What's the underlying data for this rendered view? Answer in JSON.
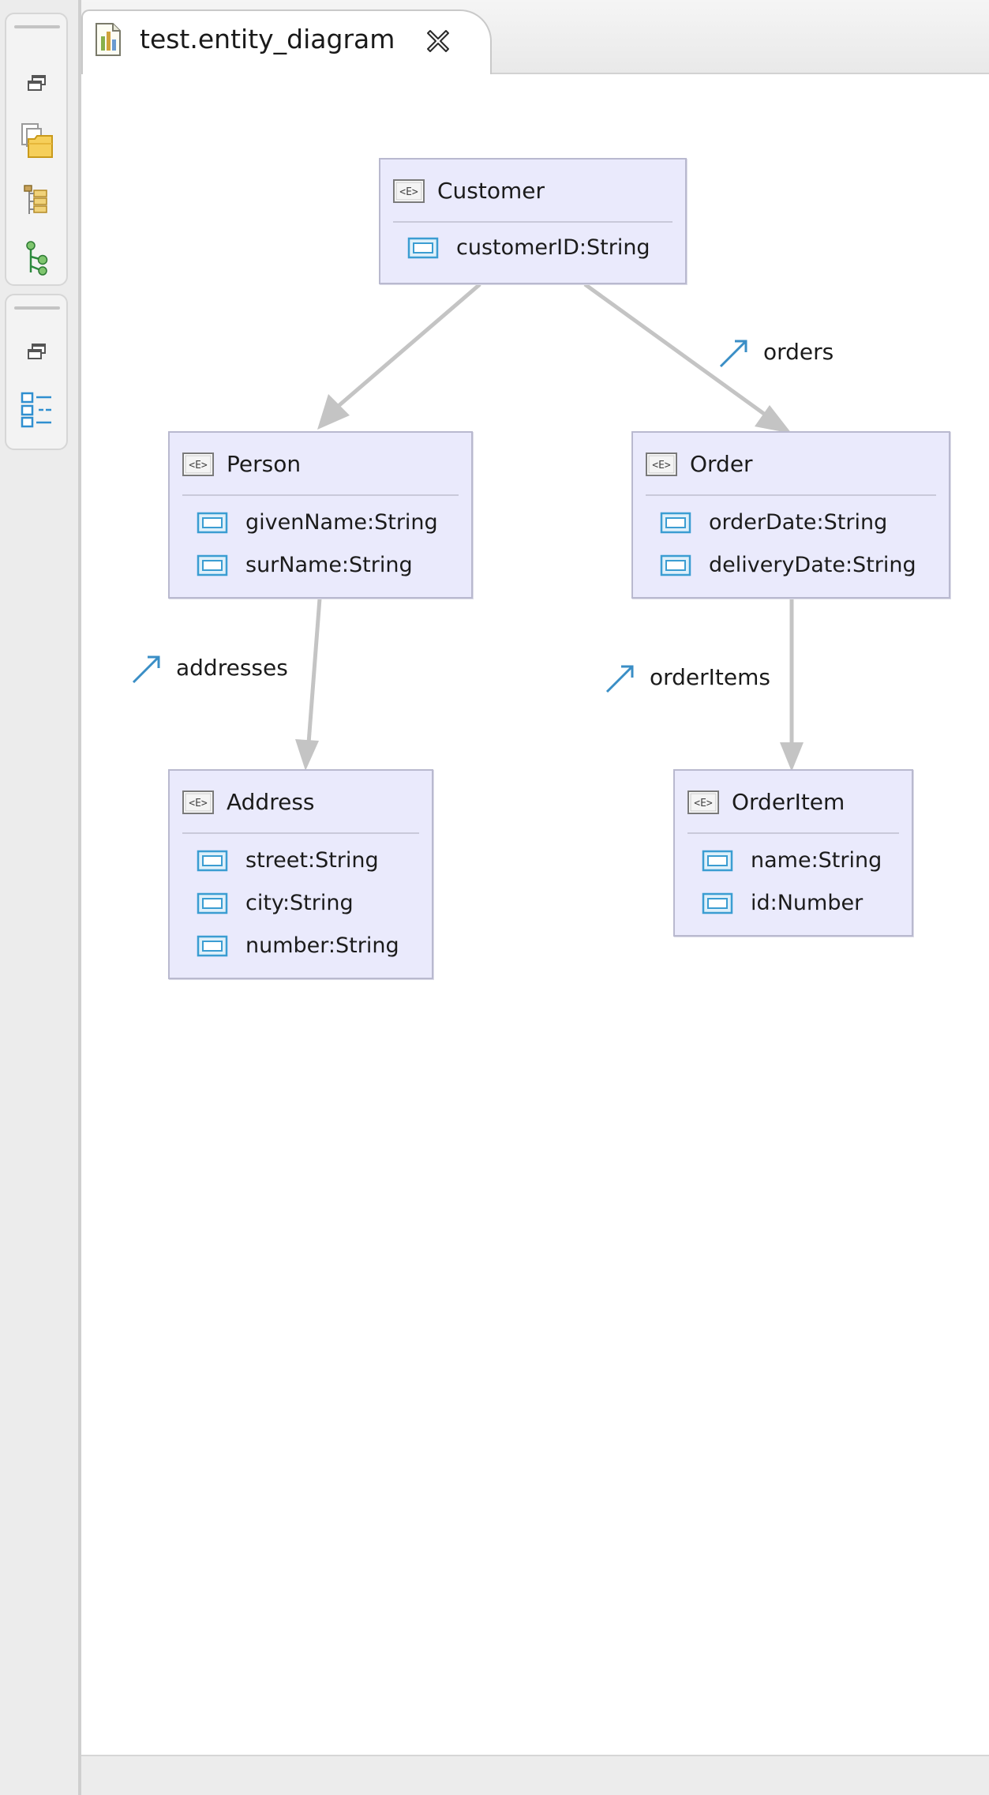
{
  "editor": {
    "tab_title": "test.entity_diagram",
    "tab_icon": "diagram-file-icon",
    "close_icon": "close-tab-icon"
  },
  "toolbar": {
    "group1_icons": [
      "restore-icon",
      "package-explorer-icon",
      "hierarchy-icon",
      "git-tree-icon"
    ],
    "group2_icons": [
      "restore-icon",
      "outline-icon"
    ]
  },
  "entities": {
    "customer": {
      "name": "Customer",
      "attributes": [
        "customerID:String"
      ]
    },
    "person": {
      "name": "Person",
      "attributes": [
        "givenName:String",
        "surName:String"
      ]
    },
    "order": {
      "name": "Order",
      "attributes": [
        "orderDate:String",
        "deliveryDate:String"
      ]
    },
    "address": {
      "name": "Address",
      "attributes": [
        "street:String",
        "city:String",
        "number:String"
      ]
    },
    "orderitem": {
      "name": "OrderItem",
      "attributes": [
        "name:String",
        "id:Number"
      ]
    }
  },
  "relations": {
    "orders": "orders",
    "addresses": "addresses",
    "order_items": "orderItems"
  },
  "colors": {
    "entity_fill": "#eaeafc",
    "entity_border": "#b9b9cf",
    "connector": "#c4c4c4",
    "icon_blue": "#3b9dd2"
  }
}
